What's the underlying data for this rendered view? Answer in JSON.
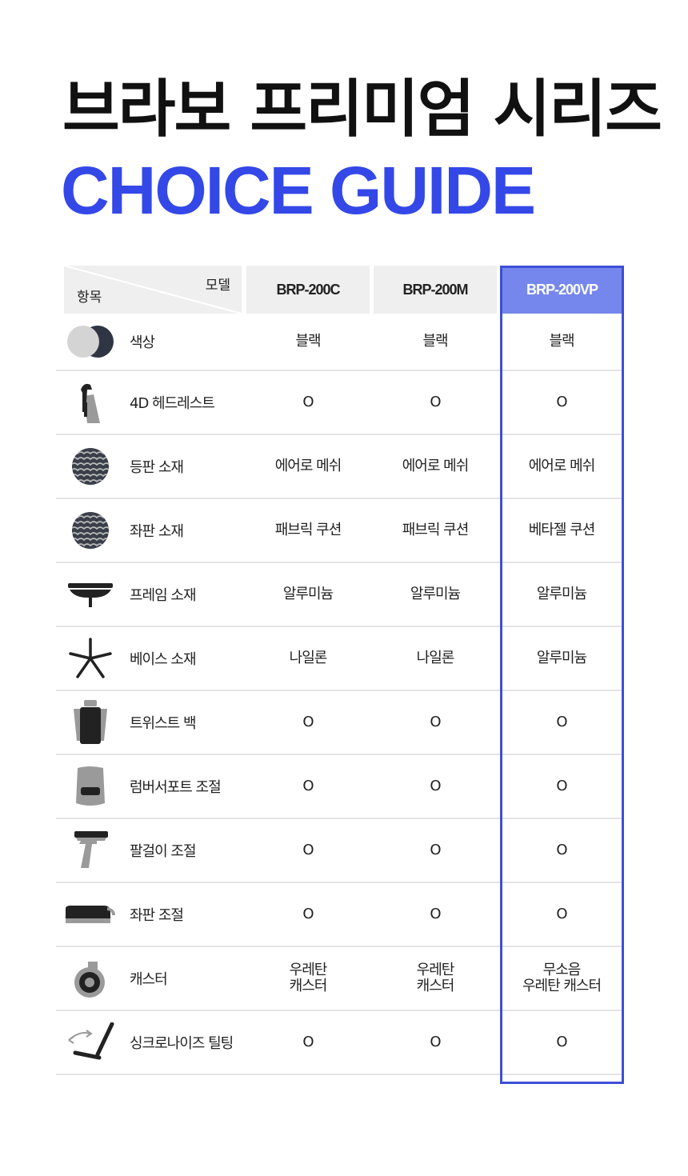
{
  "title_ko": "브라보 프리미엄 시리즈",
  "title_en": "CHOICE GUIDE",
  "colors": {
    "accent": "#3448e8",
    "highlight_header": "#7587ec",
    "highlight_border": "#3d4fd6"
  },
  "table": {
    "corner_model": "모델",
    "corner_item": "항목",
    "models": [
      "BRP-200C",
      "BRP-200M",
      "BRP-200VP"
    ],
    "rows": [
      {
        "icon": "color-swatch-icon",
        "label": "색상",
        "values": [
          "블랙",
          "블랙",
          "블랙"
        ]
      },
      {
        "icon": "headrest-icon",
        "label": "4D 헤드레스트",
        "values": [
          "O",
          "O",
          "O"
        ]
      },
      {
        "icon": "mesh-pattern-icon",
        "label": "등판 소재",
        "values": [
          "에어로 메쉬",
          "에어로 메쉬",
          "에어로 메쉬"
        ]
      },
      {
        "icon": "mesh-pattern-icon",
        "label": "좌판 소재",
        "values": [
          "패브릭 쿠션",
          "패브릭 쿠션",
          "베타젤 쿠션"
        ]
      },
      {
        "icon": "frame-icon",
        "label": "프레임 소재",
        "values": [
          "알루미늄",
          "알루미늄",
          "알루미늄"
        ]
      },
      {
        "icon": "star-base-icon",
        "label": "베이스 소재",
        "values": [
          "나일론",
          "나일론",
          "알루미늄"
        ]
      },
      {
        "icon": "twist-back-icon",
        "label": "트위스트 백",
        "values": [
          "O",
          "O",
          "O"
        ]
      },
      {
        "icon": "lumbar-support-icon",
        "label": "럼버서포트 조절",
        "values": [
          "O",
          "O",
          "O"
        ]
      },
      {
        "icon": "armrest-icon",
        "label": "팔걸이 조절",
        "values": [
          "O",
          "O",
          "O"
        ]
      },
      {
        "icon": "seat-slide-icon",
        "label": "좌판 조절",
        "values": [
          "O",
          "O",
          "O"
        ]
      },
      {
        "icon": "caster-icon",
        "label": "캐스터",
        "values": [
          "우레탄\n캐스터",
          "우레탄\n캐스터",
          "무소음\n우레탄 캐스터"
        ]
      },
      {
        "icon": "tilt-icon",
        "label": "싱크로나이즈 틸팅",
        "values": [
          "O",
          "O",
          "O"
        ]
      }
    ]
  }
}
